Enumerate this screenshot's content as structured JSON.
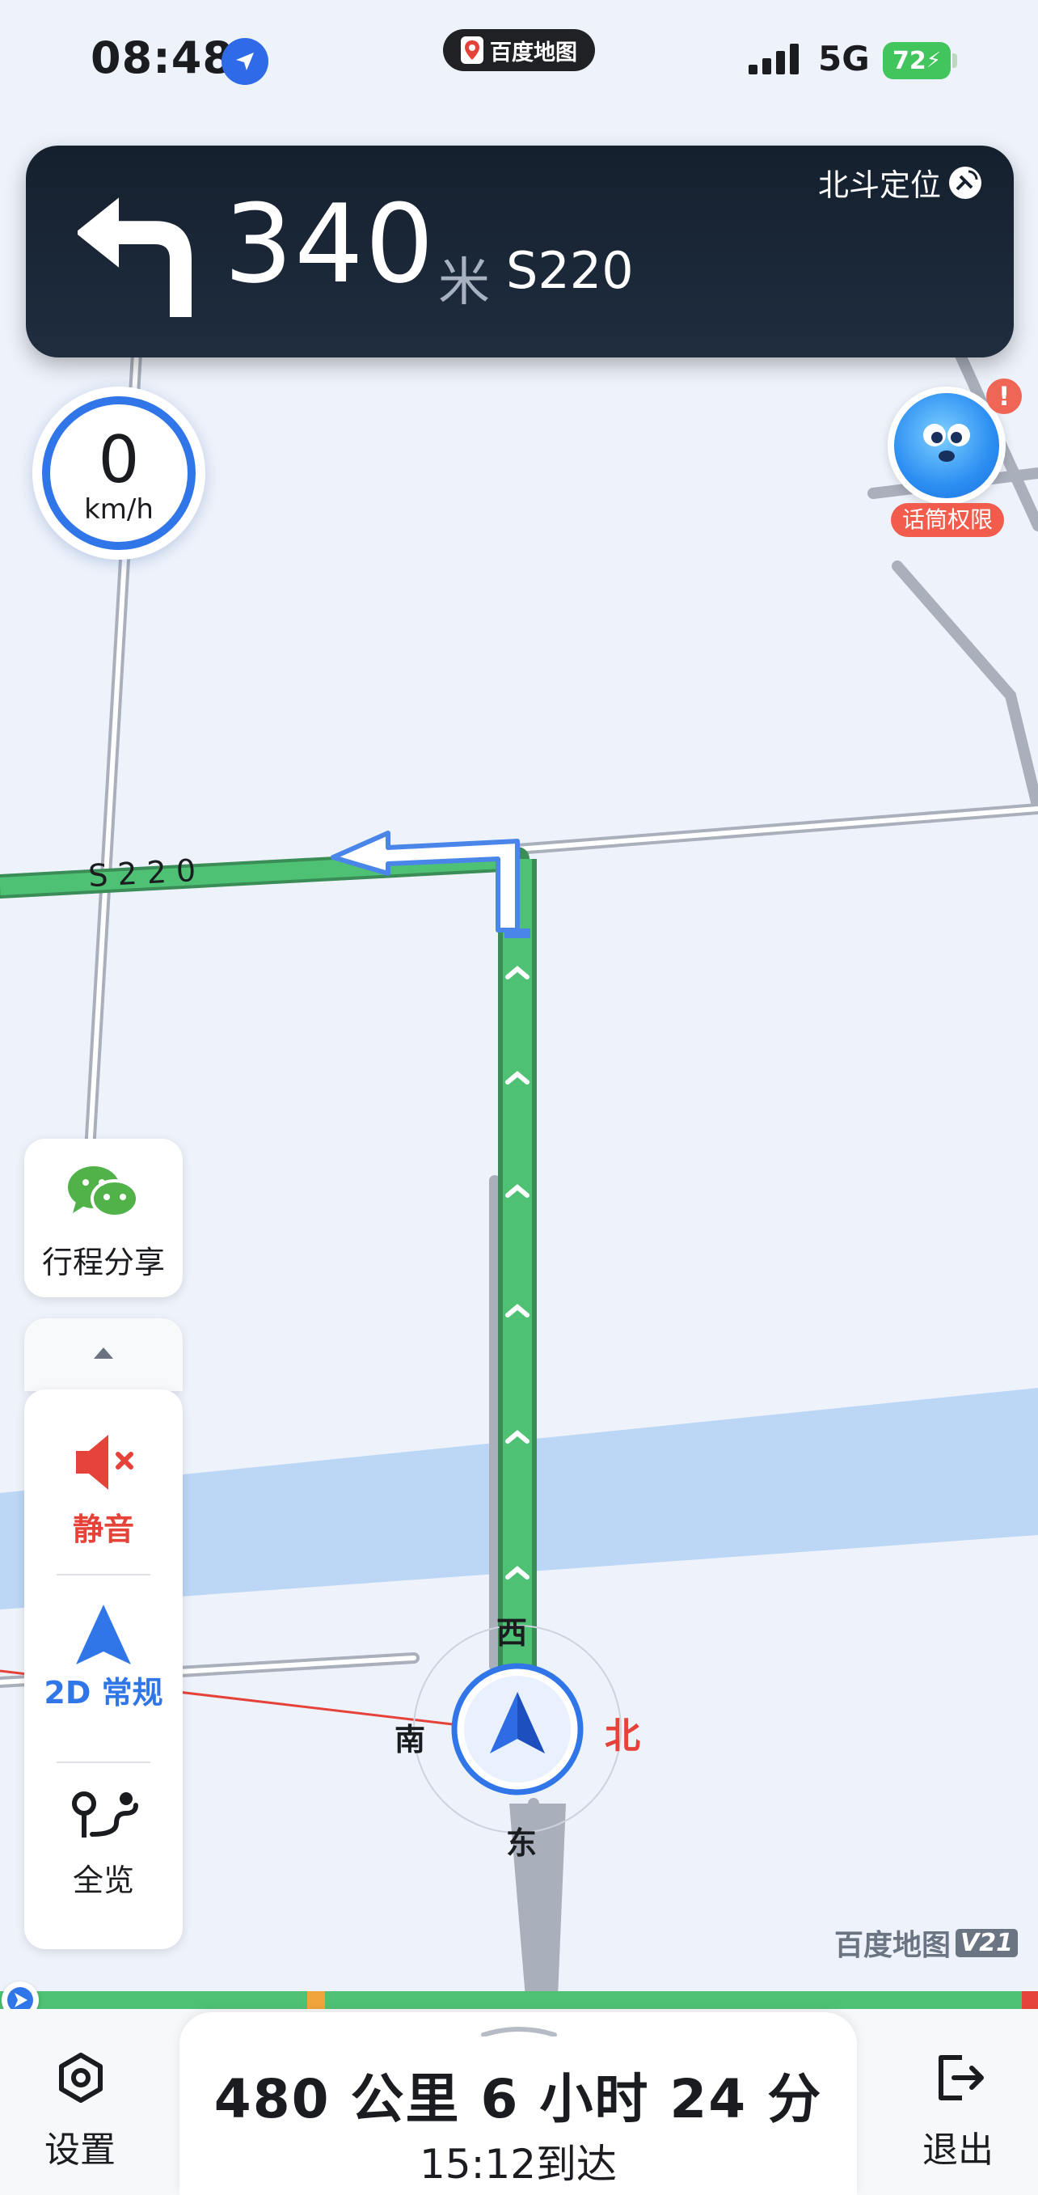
{
  "status_bar": {
    "time": "08:48",
    "app_name": "百度地图",
    "network": "5G",
    "battery": "72"
  },
  "guidance": {
    "distance": "340",
    "unit": "米",
    "road": "S220",
    "positioning": "北斗定位",
    "turn_icon": "turn-left-icon"
  },
  "speedometer": {
    "value": "0",
    "unit": "km/h"
  },
  "assistant": {
    "label": "话筒权限",
    "badge": "!"
  },
  "map": {
    "road_label": "S 2 2 0",
    "compass": {
      "west": "西",
      "south": "南",
      "north": "北",
      "east": "东"
    },
    "watermark": "百度地图",
    "watermark_version": "V21",
    "colors": {
      "route": "#4ec174",
      "water": "#bcd6f5",
      "road": "#a9b0bc",
      "north": "#e5433a",
      "accent": "#3076e9"
    }
  },
  "side_tools": {
    "share": "行程分享",
    "mute": "静音",
    "mode": "2D 常规",
    "overview": "全览"
  },
  "bottom_bar": {
    "settings": "设置",
    "eta_main": "480 公里 6 小时 24 分",
    "eta_sub": "15:12到达",
    "exit": "退出"
  }
}
